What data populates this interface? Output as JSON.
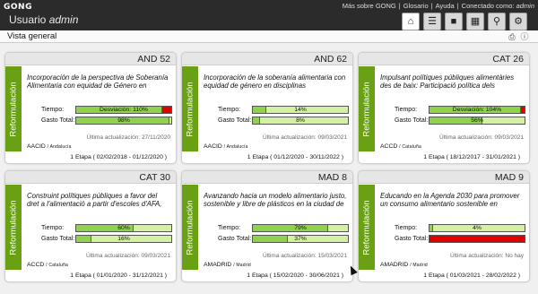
{
  "header": {
    "logo": "GONG",
    "user_prefix": "Usuario",
    "user_name": "admin",
    "links": {
      "about": "Más sobre GONG",
      "glossary": "Glosario",
      "help": "Ayuda",
      "connected_as": "Conectado como:",
      "connected_user": "admin"
    }
  },
  "toolbar_icons": [
    "home-icon",
    "list-icon",
    "folder-icon",
    "calendar-icon",
    "key-icon",
    "tools-icon"
  ],
  "subbar": {
    "title": "Vista general",
    "icons": [
      "print-icon",
      "info-icon"
    ]
  },
  "labels": {
    "tiempo": "Tiempo:",
    "gasto": "Gasto Total:",
    "status": "Reformulación"
  },
  "colors": {
    "green_bar": "#8ed34b",
    "light_bar": "#d4f0a3",
    "red_bar": "#e30000",
    "stripe": "#6aa114"
  },
  "cards": [
    {
      "code": "AND 52",
      "title": "Incorporación de la perspectiva de Soberanía Alimentaria con equidad de Género en",
      "tiempo": {
        "text": "Desviación: 110%",
        "fill_percent": 91,
        "overflow_percent": 9,
        "bg": "light"
      },
      "gasto": {
        "text": "98%",
        "fill_percent": 98,
        "bg": "light"
      },
      "update": "Última actualización: 27/11/2020",
      "org": "AACID",
      "region": "Andalucía",
      "etapa": "1 Etapa  ( 02/02/2018 - 01/12/2020 )"
    },
    {
      "code": "AND 62",
      "title": "Incorporación de la soberanía alimentaria con equidad de género en disciplinas",
      "tiempo": {
        "text": "14%",
        "fill_percent": 14,
        "bg": "light"
      },
      "gasto": {
        "text": "8%",
        "fill_percent": 8,
        "bg": "light"
      },
      "update": "Última actualización: 09/03/2021",
      "org": "AACID",
      "region": "Andalucía",
      "etapa": "1 Etapa  ( 01/12/2020 - 30/11/2022 )"
    },
    {
      "code": "CAT 26",
      "title": "Impulsant polítiques públiques alimentàries des de baix: Participació política dels",
      "tiempo": {
        "text": "Desviación: 104%",
        "fill_percent": 96,
        "overflow_percent": 4,
        "bg": "light"
      },
      "gasto": {
        "text": "56%",
        "fill_percent": 56,
        "bg": "light"
      },
      "update": "Última actualización: 09/03/2021",
      "org": "ACCD",
      "region": "Cataluña",
      "etapa": "1 Etapa  ( 18/12/2017 - 31/01/2021 )"
    },
    {
      "code": "CAT 30",
      "title": "Construint polítiques públiques a favor del dret a l'alimentació a partir d'escoles d'AFA,",
      "tiempo": {
        "text": "60%",
        "fill_percent": 60,
        "bg": "light"
      },
      "gasto": {
        "text": "16%",
        "fill_percent": 16,
        "bg": "light"
      },
      "update": "Última actualización: 09/03/2021",
      "org": "ACCD",
      "region": "Cataluña",
      "etapa": "1 Etapa  ( 01/01/2020 - 31/12/2021 )"
    },
    {
      "code": "MAD 8",
      "title": "Avanzando hacia un modelo alimentario justo, sostenible y libre de plásticos en la ciudad de",
      "tiempo": {
        "text": "79%",
        "fill_percent": 79,
        "bg": "light"
      },
      "gasto": {
        "text": "37%",
        "fill_percent": 37,
        "bg": "light"
      },
      "update": "Última actualización: 15/03/2021",
      "org": "AMADRID",
      "region": "Madrid",
      "etapa": "1 Etapa  ( 15/02/2020 - 30/06/2021 )"
    },
    {
      "code": "MAD 9",
      "title": "Educando en la Agenda 2030 para promover un consumo alimentario sostenible en",
      "tiempo": {
        "text": "4%",
        "fill_percent": 4,
        "bg": "light"
      },
      "gasto": {
        "text": "",
        "fill_percent": 0,
        "bg": "red"
      },
      "update": "Última actualización: No hay",
      "org": "AMADRID",
      "region": "Madrid",
      "etapa": "1 Etapa  ( 01/03/2021 - 28/02/2022 )"
    }
  ]
}
